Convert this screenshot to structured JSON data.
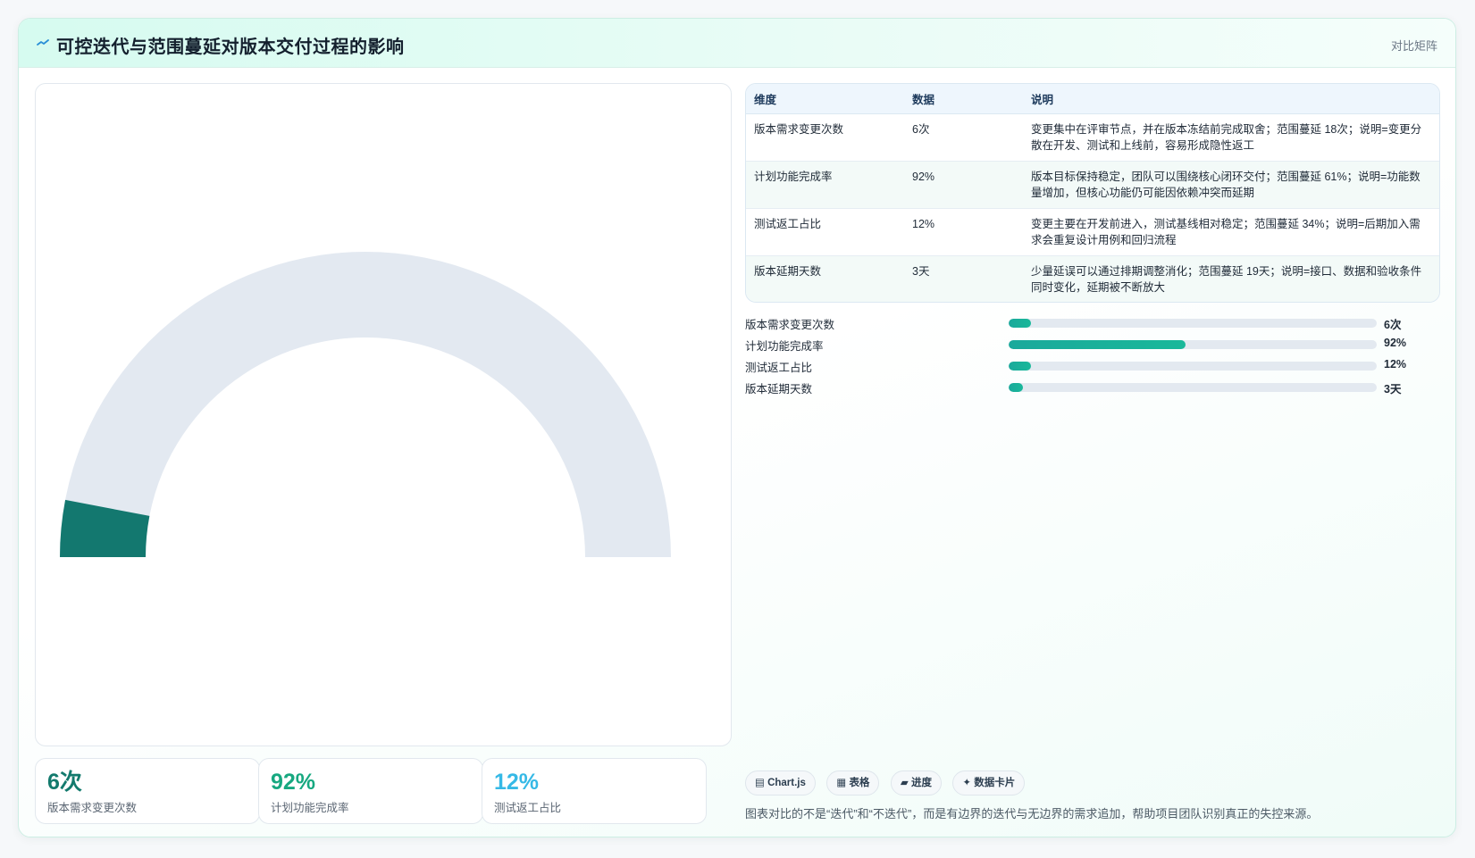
{
  "header": {
    "icon": "trend-spark-icon",
    "title": "可控迭代与范围蔓延对版本交付过程的影响",
    "link_label": "对比矩阵"
  },
  "colors": {
    "gauge_value": "#13786f",
    "gauge_track": "#e3e9f1",
    "bar_fill": "#1aaa9b",
    "stat_0": "#137a6d",
    "stat_1": "#17a880",
    "stat_2": "#36b9e6"
  },
  "chart_data": {
    "type": "gauge",
    "value": 6,
    "max": 100,
    "unit": "次",
    "label": "版本需求变更次数"
  },
  "stats": [
    {
      "value": "6次",
      "label": "版本需求变更次数"
    },
    {
      "value": "92%",
      "label": "计划功能完成率"
    },
    {
      "value": "12%",
      "label": "测试返工占比"
    }
  ],
  "table": {
    "headers": [
      "维度",
      "数据",
      "说明"
    ],
    "rows": [
      {
        "dimension": "版本需求变更次数",
        "value": "6次",
        "note": "变更集中在评审节点，并在版本冻结前完成取舍；范围蔓延 18次；说明=变更分散在开发、测试和上线前，容易形成隐性返工"
      },
      {
        "dimension": "计划功能完成率",
        "value": "92%",
        "note": "版本目标保持稳定，团队可以围绕核心闭环交付；范围蔓延 61%；说明=功能数量增加，但核心功能仍可能因依赖冲突而延期"
      },
      {
        "dimension": "测试返工占比",
        "value": "12%",
        "note": "变更主要在开发前进入，测试基线相对稳定；范围蔓延 34%；说明=后期加入需求会重复设计用例和回归流程"
      },
      {
        "dimension": "版本延期天数",
        "value": "3天",
        "note": "少量延误可以通过排期调整消化；范围蔓延 19天；说明=接口、数据和验收条件同时变化，延期被不断放大"
      }
    ]
  },
  "bars": [
    {
      "label": "版本需求变更次数",
      "value_text": "6次",
      "percent": 6
    },
    {
      "label": "计划功能完成率",
      "value_text": "92%",
      "percent": 48
    },
    {
      "label": "测试返工占比",
      "value_text": "12%",
      "percent": 6
    },
    {
      "label": "版本延期天数",
      "value_text": "3天",
      "percent": 4
    }
  ],
  "chips": [
    {
      "icon": "chart-icon",
      "glyph": "▤",
      "label": "Chart.js"
    },
    {
      "icon": "table-icon",
      "glyph": "▦",
      "label": "表格"
    },
    {
      "icon": "progress-icon",
      "glyph": "▰",
      "label": "进度"
    },
    {
      "icon": "sparkle-icon",
      "glyph": "✦",
      "label": "数据卡片"
    }
  ],
  "footnote": "图表对比的不是“迭代”和“不迭代”，而是有边界的迭代与无边界的需求追加，帮助项目团队识别真正的失控来源。"
}
